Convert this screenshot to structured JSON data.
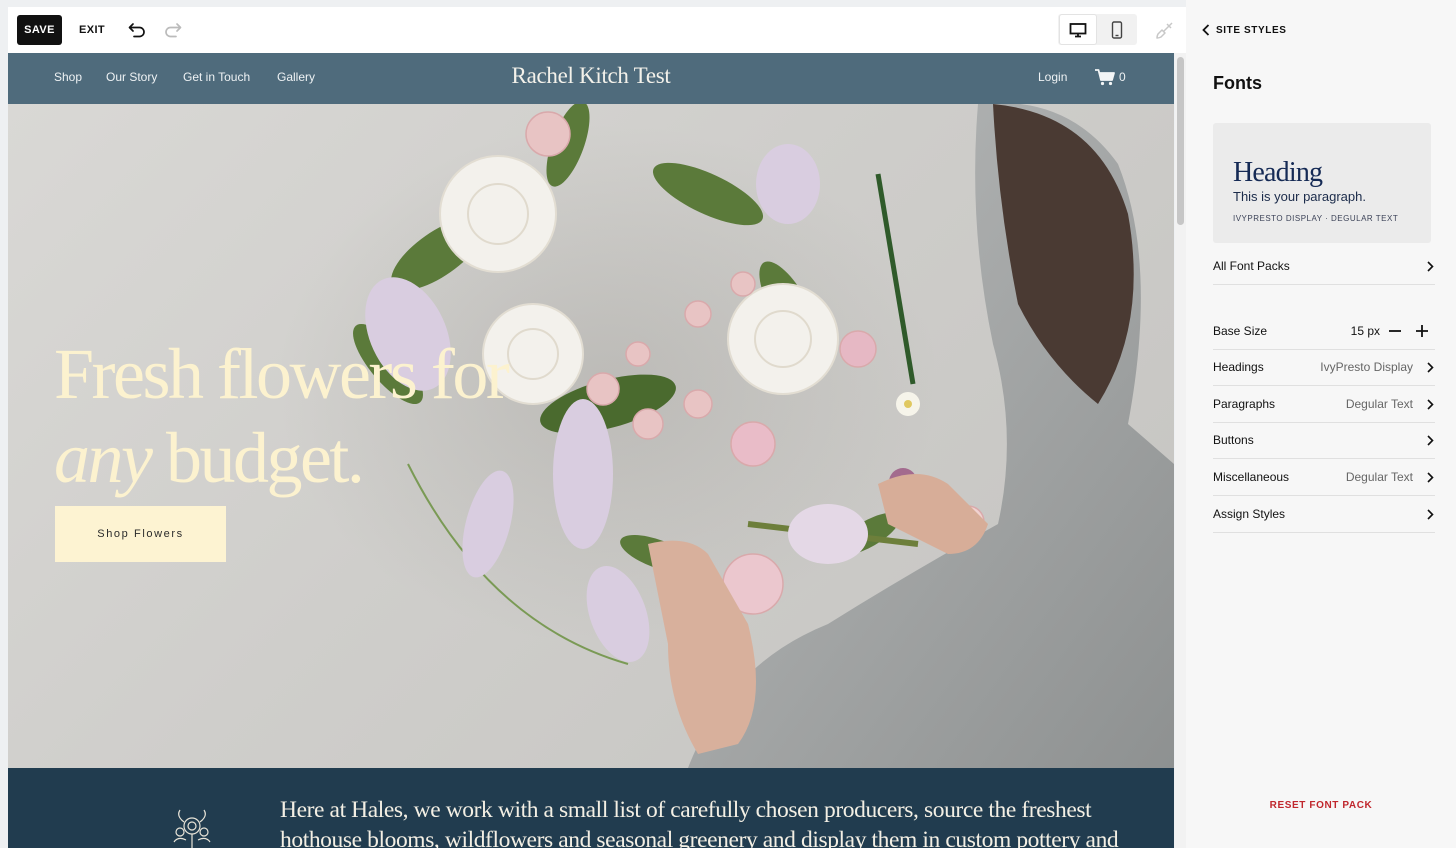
{
  "toolbar": {
    "save_label": "SAVE",
    "exit_label": "EXIT",
    "undo_icon": "undo-icon",
    "redo_icon": "redo-icon",
    "device_icons": [
      "desktop-icon",
      "mobile-icon"
    ],
    "style_icon": "paintbrush-icon"
  },
  "site": {
    "nav": {
      "links": [
        "Shop",
        "Our Story",
        "Get in Touch",
        "Gallery"
      ],
      "title": "Rachel Kitch Test",
      "login": "Login",
      "cart_count": "0",
      "cart_icon": "cart-icon"
    },
    "hero": {
      "headline_line1": "Fresh flowers for",
      "headline_line2_em": "any",
      "headline_line2_rest": " budget.",
      "button_label": "Shop Flowers"
    },
    "intro": {
      "text": "Here at Hales, we work with a small list of carefully chosen producers, source the freshest hothouse blooms, wildflowers and seasonal greenery and display them in custom pottery and",
      "icon": "floral-illustration-icon"
    }
  },
  "panel": {
    "back_label": "SITE STYLES",
    "title": "Fonts",
    "preview": {
      "heading": "Heading",
      "paragraph": "This is your paragraph.",
      "caption": "IVYPRESTO DISPLAY · DEGULAR TEXT"
    },
    "all_font_packs": "All Font Packs",
    "base_size": {
      "label": "Base Size",
      "value": "15 px"
    },
    "rows": [
      {
        "label": "Headings",
        "value": "IvyPresto Display"
      },
      {
        "label": "Paragraphs",
        "value": "Degular Text"
      },
      {
        "label": "Buttons",
        "value": ""
      },
      {
        "label": "Miscellaneous",
        "value": "Degular Text"
      },
      {
        "label": "Assign Styles",
        "value": ""
      }
    ],
    "reset_label": "RESET FONT PACK"
  },
  "colors": {
    "nav_bg": "#4f6b7c",
    "intro_bg": "#213c4f",
    "hero_text": "#fcf2cf",
    "button_bg": "#fdf3d2",
    "reset_red": "#c0272d"
  }
}
